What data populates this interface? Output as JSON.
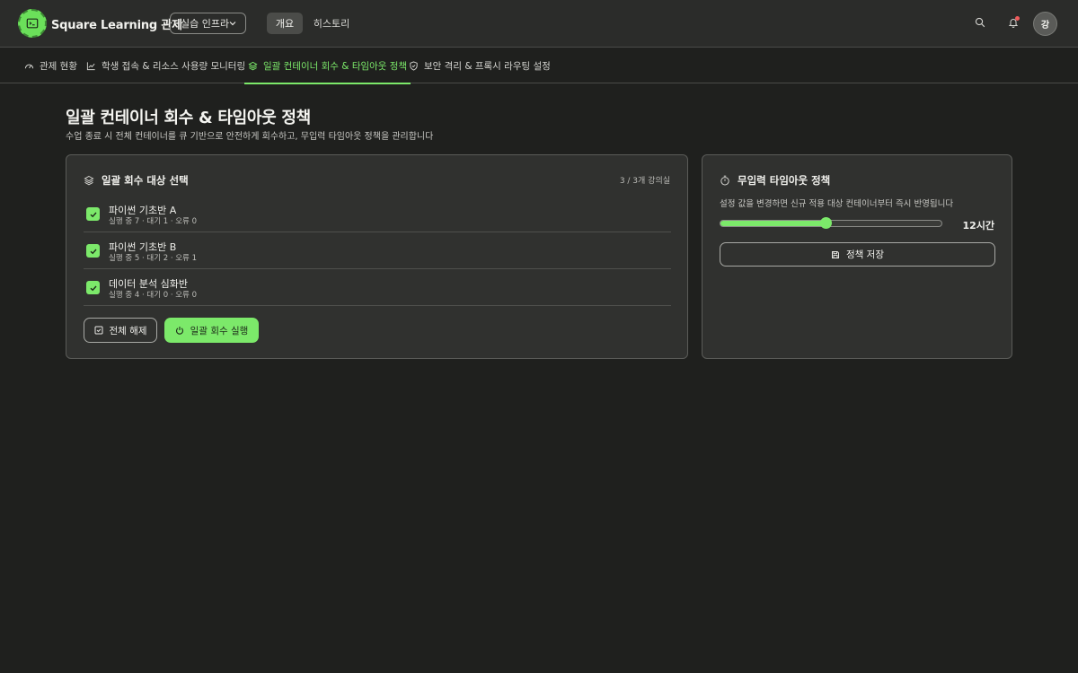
{
  "header": {
    "brand": "Square Learning 관제",
    "env_select": "실습 인프라",
    "nav": {
      "overview": "개요",
      "history": "히스토리"
    },
    "avatar_initial": "강",
    "notification_dot": true
  },
  "tabs": [
    {
      "label": "관제 현황",
      "icon": "gauge-icon",
      "active": false
    },
    {
      "label": "학생 접속 & 리소스 사용량 모니터링",
      "icon": "line-chart-icon",
      "active": false
    },
    {
      "label": "일괄 컨테이너 회수 & 타임아웃 정책",
      "icon": "layers-icon",
      "active": true
    },
    {
      "label": "보안 격리 & 프록시 라우팅 설정",
      "icon": "shield-icon",
      "active": false
    }
  ],
  "page": {
    "title": "일괄 컨테이너 회수 & 타임아웃 정책",
    "subtitle": "수업 종료 시 전체 컨테이너를 큐 기반으로 안전하게 회수하고, 무입력 타임아웃 정책을 관리합니다"
  },
  "bulk": {
    "title": "일괄 회수 대상 선택",
    "count": "3 / 3개 강의실",
    "rooms": [
      {
        "name": "파이썬 기초반 A",
        "stats": "실행 중 7 · 대기 1 · 오류 0",
        "checked": true
      },
      {
        "name": "파이썬 기초반 B",
        "stats": "실행 중 5 · 대기 2 · 오류 1",
        "checked": true
      },
      {
        "name": "데이터 분석 심화반",
        "stats": "실행 중 4 · 대기 0 · 오류 0",
        "checked": true
      }
    ],
    "deselect_label": "전체 해제",
    "run_label": "일괄 회수 실행"
  },
  "timeout": {
    "title": "무입력 타임아웃 정책",
    "description": "설정 값을 변경하면 신규 적용 대상 컨테이너부터 즉시 반영됩니다",
    "slider_fraction": 0.48,
    "value_label": "12시간",
    "save_label": "정책 저장"
  },
  "colors": {
    "accent": "#7ce96a",
    "background": "#1f201e",
    "card": "#30312f",
    "notification": "#ef5b5b"
  }
}
